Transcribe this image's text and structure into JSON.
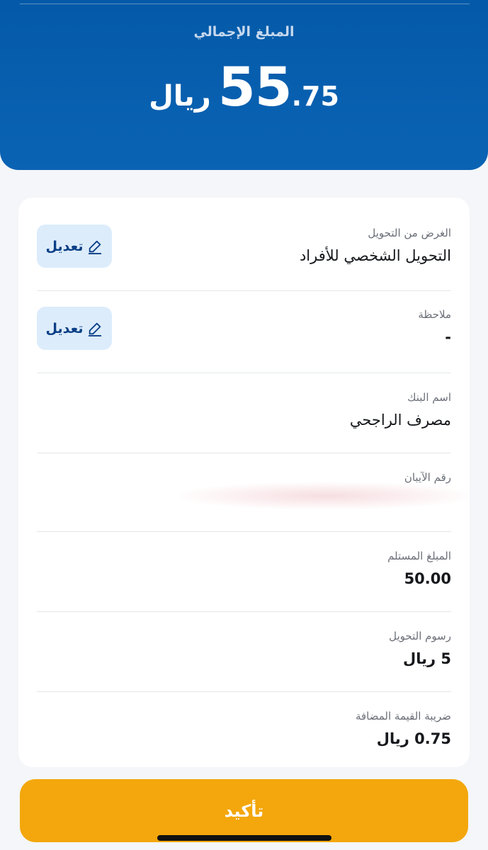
{
  "header": {
    "total_label": "المبلغ الإجمالي",
    "amount_integer": "55",
    "amount_decimal": ".75",
    "currency": "ريال"
  },
  "details": {
    "purpose": {
      "label": "الغرض من التحويل",
      "value": "التحويل الشخصي للأفراد",
      "edit_label": "تعديل"
    },
    "note": {
      "label": "ملاحظة",
      "value": "-",
      "edit_label": "تعديل"
    },
    "bank": {
      "label": "اسم البنك",
      "value": "مصرف الراجحي"
    },
    "iban": {
      "label": "رقم الآيبان",
      "value": ""
    },
    "received": {
      "label": "المبلغ المستلم",
      "value": "50.00"
    },
    "fees": {
      "label": "رسوم التحويل",
      "value": "5 ريال"
    },
    "vat": {
      "label": "ضريبة القيمة المضافة",
      "value": "0.75 ريال"
    }
  },
  "confirm_label": "تأكيد",
  "colors": {
    "header_bg": "#045aa8",
    "edit_bg": "#dcecfb",
    "edit_text": "#0b3f86",
    "confirm_bg": "#f3a70c"
  },
  "icons": {
    "edit": "pencil-icon"
  }
}
